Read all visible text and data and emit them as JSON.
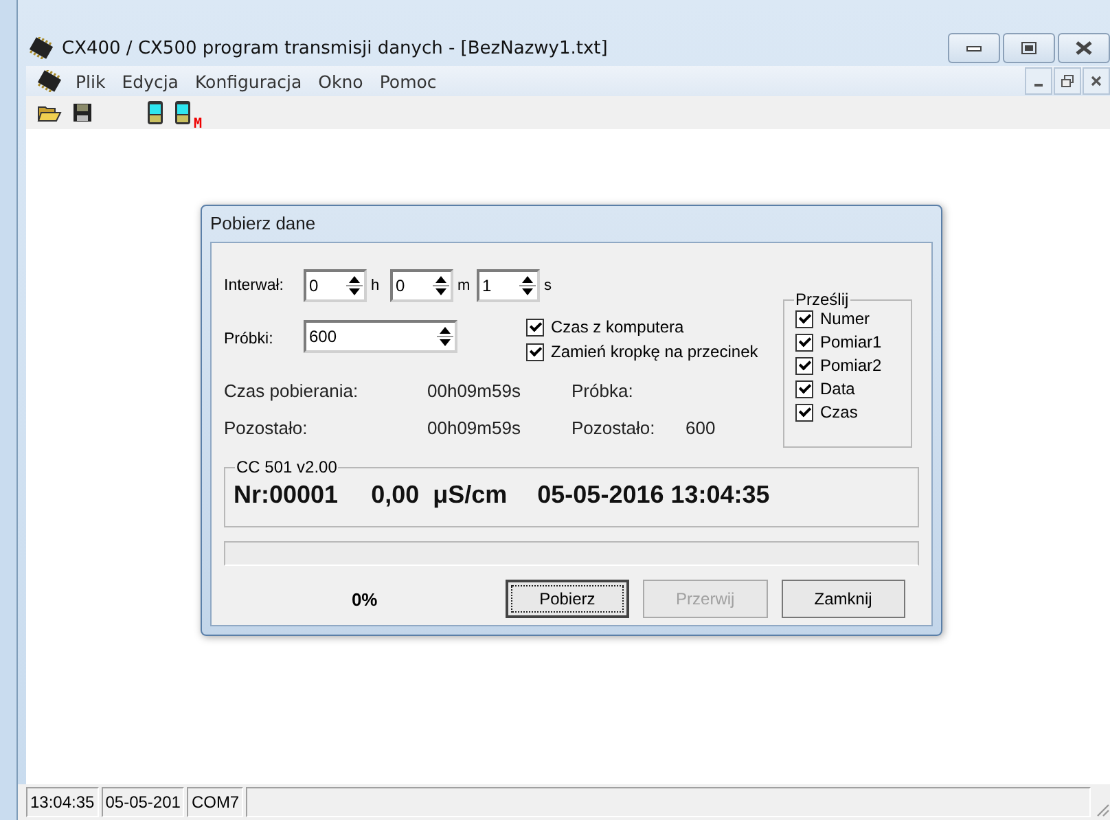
{
  "window": {
    "title": "CX400 / CX500 program transmisji danych - [BezNazwy1.txt]"
  },
  "menu": [
    {
      "label": "Plik"
    },
    {
      "label": "Edycja"
    },
    {
      "label": "Konfiguracja"
    },
    {
      "label": "Okno"
    },
    {
      "label": "Pomoc"
    }
  ],
  "toolbar": [
    {
      "kind": "open"
    },
    {
      "kind": "save"
    },
    {
      "kind": "gap"
    },
    {
      "kind": "device"
    },
    {
      "kind": "device-badge",
      "badge": "M"
    }
  ],
  "dialog": {
    "title": "Pobierz dane",
    "interval": {
      "label": "Interwał:",
      "fields": [
        {
          "value": "0",
          "unit": "h"
        },
        {
          "value": "0",
          "unit": "m"
        },
        {
          "value": "1",
          "unit": "s"
        }
      ]
    },
    "samples": {
      "label": "Próbki:",
      "value": "600"
    },
    "options": [
      {
        "label": "Czas z komputera",
        "checked": true
      },
      {
        "label": "Zamień kropkę na przecinek",
        "checked": true
      }
    ],
    "stats": [
      [
        "Czas pobierania:",
        "00h09m59s",
        "Próbka:"
      ],
      [
        "Pozostało:",
        "00h09m59s",
        "Pozostało:",
        "600"
      ]
    ],
    "send": {
      "title": "Prześlij",
      "items": [
        {
          "label": "Numer",
          "checked": true
        },
        {
          "label": "Pomiar1",
          "checked": true
        },
        {
          "label": "Pomiar2",
          "checked": true
        },
        {
          "label": "Data",
          "checked": true
        },
        {
          "label": "Czas",
          "checked": true
        }
      ]
    },
    "reading": {
      "title": "CC 501 v2.00",
      "number": "Nr:00001",
      "value": "0,00",
      "unit": "μS/cm",
      "timestamp": "05-05-2016 13:04:35"
    },
    "progress": {
      "level": 0,
      "percent": "0%"
    },
    "buttons": [
      {
        "label": "Pobierz",
        "disabled": false,
        "focused": true
      },
      {
        "label": "Przerwij",
        "disabled": true,
        "focused": false
      },
      {
        "label": "Zamknij",
        "disabled": false,
        "focused": false
      }
    ]
  },
  "status_bar": [
    "13:04:35",
    "05-05-201",
    "COM7"
  ]
}
